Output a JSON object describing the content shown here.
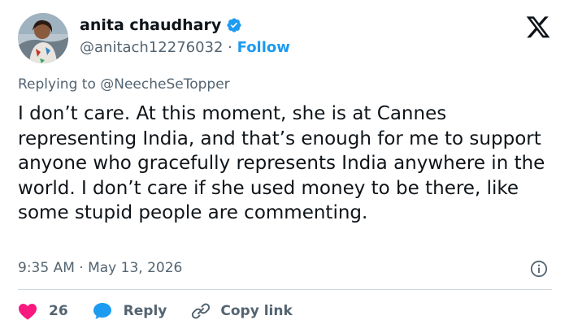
{
  "author": {
    "display_name": "anita chaudhary",
    "handle": "@anitach12276032",
    "separator": " · ",
    "follow_label": "Follow",
    "verified": true
  },
  "brand": {
    "logo": "x-logo-icon"
  },
  "reply_context": {
    "prefix": "Replying to ",
    "mention": "@NeecheSeTopper"
  },
  "tweet": {
    "text": "I don’t care. At this moment, she is at Cannes representing India, and that’s enough for me to support anyone who gracefully represents India anywhere in the world. I don’t care if she used money to be there, like some stupid people are commenting.",
    "timestamp": "9:35 AM · May 13, 2026"
  },
  "actions": {
    "like_count": "26",
    "reply_label": "Reply",
    "copy_link_label": "Copy link"
  },
  "icons": {
    "verified": "verified-badge-icon",
    "info": "info-icon",
    "like": "heart-icon",
    "reply": "speech-bubble-icon",
    "copy_link": "link-icon"
  },
  "colors": {
    "accent": "#1d9bf0",
    "text_primary": "#0f1419",
    "text_secondary": "#536471",
    "like": "#f91880",
    "divider": "#cfd9de"
  }
}
